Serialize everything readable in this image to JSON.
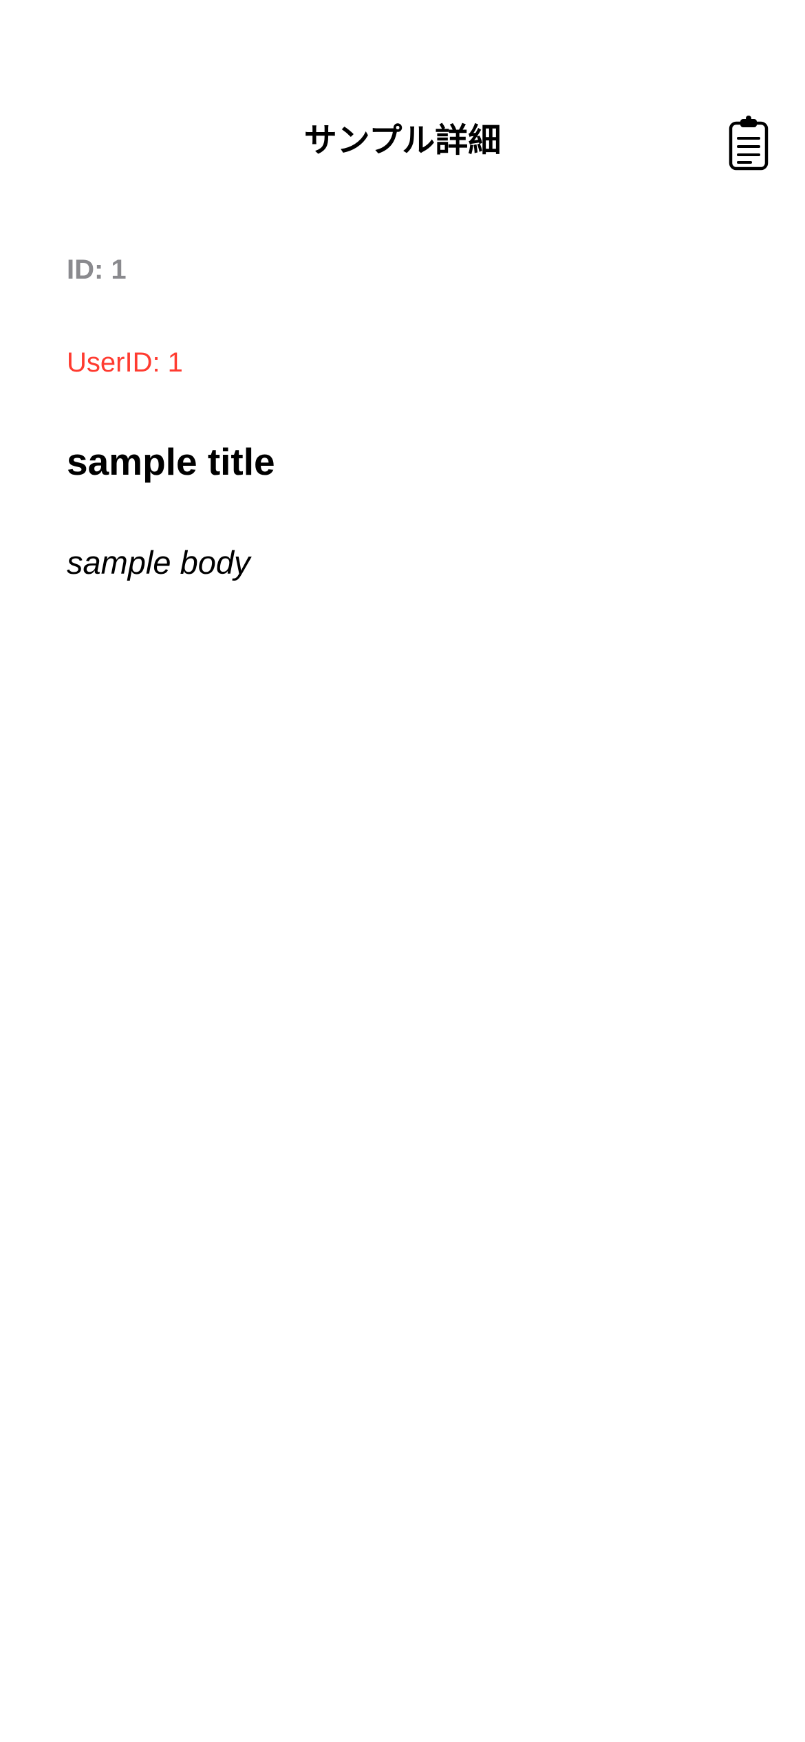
{
  "nav": {
    "title": "サンプル詳細",
    "action_icon": "clipboard-icon"
  },
  "post": {
    "id_label": "ID: 1",
    "user_id_label": "UserID: 1",
    "title": "sample title",
    "body": "sample body"
  },
  "colors": {
    "background": "#ffffff",
    "id_text": "#8a8a8e",
    "user_id_text": "#ff3b30",
    "primary_text": "#000000"
  }
}
